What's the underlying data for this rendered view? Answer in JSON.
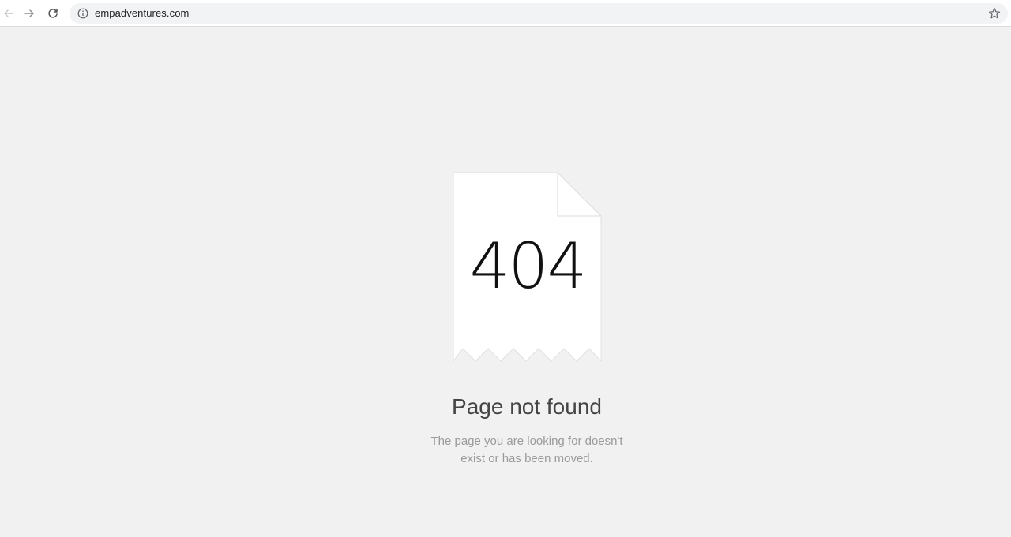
{
  "browser": {
    "back_icon": "arrow-left-icon",
    "forward_icon": "arrow-right-icon",
    "reload_icon": "reload-icon",
    "site_info_icon": "info-icon",
    "bookmark_icon": "star-icon",
    "url": "empadventures.com"
  },
  "error_page": {
    "code": "404",
    "title": "Page not found",
    "description_line1": "The page you are looking for doesn't",
    "description_line2": "exist or has been moved."
  },
  "colors": {
    "page_background": "#f1f1f1",
    "document_fill": "#ffffff",
    "title_text": "#444444",
    "description_text": "#9a9a9a"
  }
}
